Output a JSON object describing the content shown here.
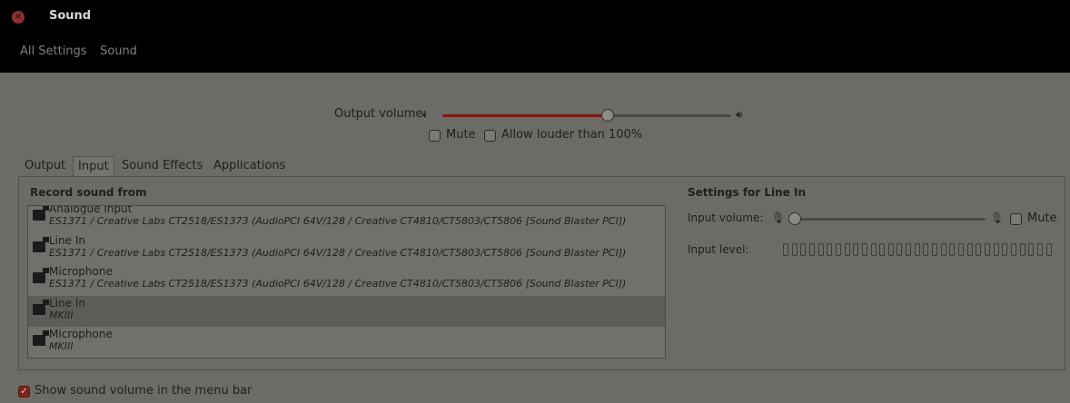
{
  "window": {
    "title": "Sound",
    "close_icon": "close-icon"
  },
  "header": {
    "breadcrumb_all": "All Settings",
    "breadcrumb_current": "Sound"
  },
  "output": {
    "volume_label": "Output volume:",
    "volume_percent": 57,
    "mute_label": "Mute",
    "mute_checked": false,
    "louder_label": "Allow louder than 100%",
    "louder_checked": false
  },
  "tabs": [
    {
      "label": "Output",
      "active": false
    },
    {
      "label": "Input",
      "active": true
    },
    {
      "label": "Sound Effects",
      "active": false
    },
    {
      "label": "Applications",
      "active": false
    }
  ],
  "input": {
    "record_heading": "Record sound from",
    "devices": [
      {
        "name": "Analogue Input",
        "desc": "ES1371 / Creative Labs CT2518/ES1373 (AudioPCI 64V/128 / Creative CT4810/CT5803/CT5806 [Sound Blaster PCI])",
        "selected": false
      },
      {
        "name": "Line In",
        "desc": "ES1371 / Creative Labs CT2518/ES1373 (AudioPCI 64V/128 / Creative CT4810/CT5803/CT5806 [Sound Blaster PCI])",
        "selected": false
      },
      {
        "name": "Microphone",
        "desc": "ES1371 / Creative Labs CT2518/ES1373 (AudioPCI 64V/128 / Creative CT4810/CT5803/CT5806 [Sound Blaster PCI])",
        "selected": false
      },
      {
        "name": "Line In",
        "desc": "MKIII",
        "selected": true
      },
      {
        "name": "Microphone",
        "desc": "MKIII",
        "selected": false
      }
    ],
    "settings_heading": "Settings for Line In",
    "volume_label": "Input volume:",
    "volume_percent": 0,
    "mute_label": "Mute",
    "mute_checked": false,
    "level_label": "Input level:",
    "level_segments_lit": 0
  },
  "footer": {
    "show_volume_label": "Show sound volume in the menu bar",
    "show_volume_checked": true
  },
  "colors": {
    "accent": "#7a1a12",
    "titlebar": "#000000",
    "background": "#6c6b67"
  }
}
